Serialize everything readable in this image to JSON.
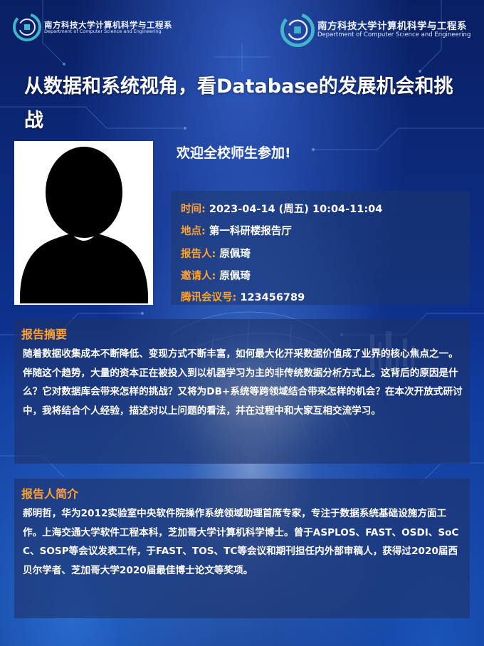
{
  "header": {
    "logo_left": {
      "name_cn": "南方科技大学计算机科学与工程系",
      "name_en": "Department of Computer Science and Engineering"
    },
    "logo_right": {
      "name_cn": "南方科技大学计算机科学与工程系",
      "name_en": "Department of Computer Science and Engineering"
    }
  },
  "title": "从数据和系统视角，看Database的发展机会和挑战",
  "welcome": "欢迎全校师生参加!",
  "speaker_photo_icon": "person-silhouette-icon",
  "info": {
    "time": {
      "label": "时间:",
      "value": "2023-04-14 (周五) 10:04-11:04"
    },
    "location": {
      "label": "地点:",
      "value": "第一科研楼报告厅"
    },
    "speaker": {
      "label": "报告人:",
      "value": "原佩琦"
    },
    "inviter": {
      "label": "邀请人:",
      "value": "原佩琦"
    },
    "meeting_id": {
      "label": "腾讯会议号:",
      "value": "123456789"
    }
  },
  "abstract": {
    "heading": "报告摘要",
    "body": "随着数据收集成本不断降低、变现方式不断丰富，如何最大化开采数据价值成了业界的核心焦点之一。伴随这个趋势，大量的资本正在被投入到以机器学习为主的非传统数据分析方式上。这背后的原因是什么？它对数据库会带来怎样的挑战？又将为DB+系统等跨领域结合带来怎样的机会？在本次开放式研讨中，我将结合个人经验，描述对以上问题的看法，并在过程中和大家互相交流学习。"
  },
  "bio": {
    "heading": "报告人简介",
    "body": "郝明哲，华为2012实验室中央软件院操作系统领域助理首席专家，专注于数据系统基础设施方面工作。上海交通大学软件工程本科，芝加哥大学计算机科学博士。曾于ASPLOS、FAST、OSDI、SoCC、SOSP等会议发表工作，于FAST、TOS、TC等会议和期刊担任内外部审稿人，获得过2020届西贝尔学者、芝加哥大学2020届最佳博士论文等奖项。"
  },
  "colors": {
    "accent": "#ffa22e",
    "background": "#0c2a7c",
    "panel": "#1e376e"
  }
}
